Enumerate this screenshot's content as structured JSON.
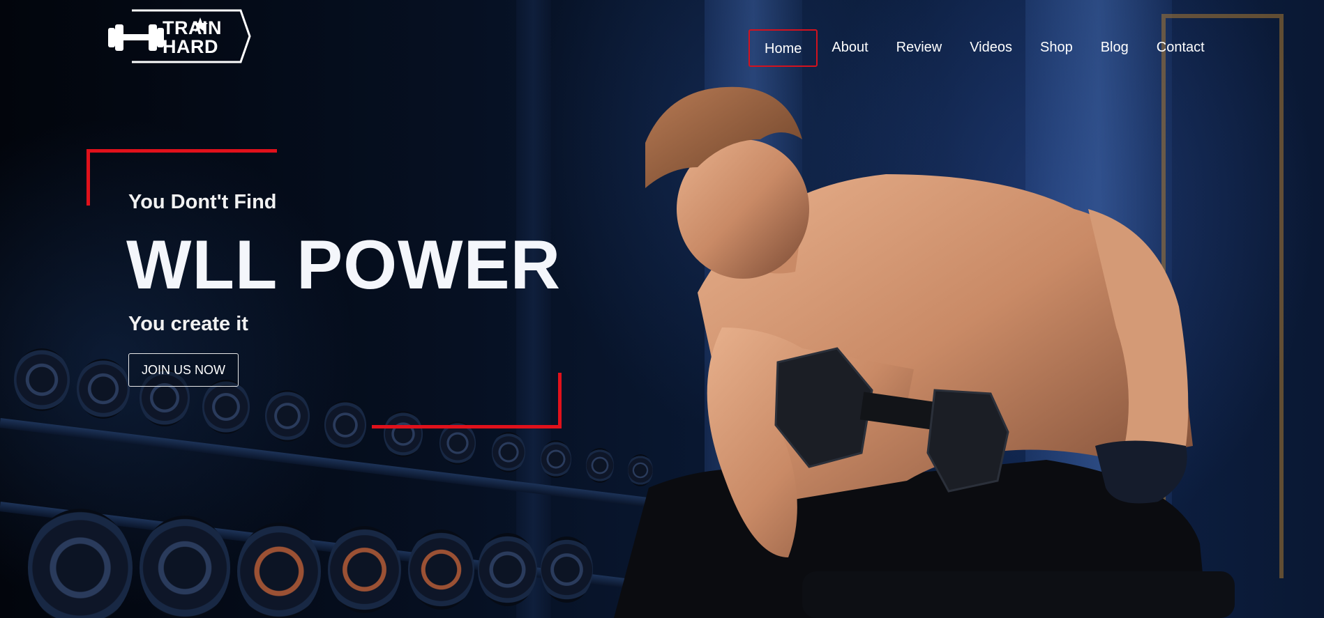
{
  "brand": {
    "logo_line1": "TRAIN",
    "logo_line2": "HARD",
    "accent": "#e0111b"
  },
  "nav": {
    "items": [
      {
        "label": "Home",
        "active": true
      },
      {
        "label": "About",
        "active": false
      },
      {
        "label": "Review",
        "active": false
      },
      {
        "label": "Videos",
        "active": false
      },
      {
        "label": "Shop",
        "active": false
      },
      {
        "label": "Blog",
        "active": false
      },
      {
        "label": "Contact",
        "active": false
      }
    ]
  },
  "hero": {
    "subtitle": "You Dont't Find",
    "title": "WLL POWER",
    "tagline": "You create it",
    "cta_label": "JOIN US NOW"
  },
  "icons": {
    "logo_icon": "dumbbell-icon",
    "logo_star": "star-icon"
  }
}
